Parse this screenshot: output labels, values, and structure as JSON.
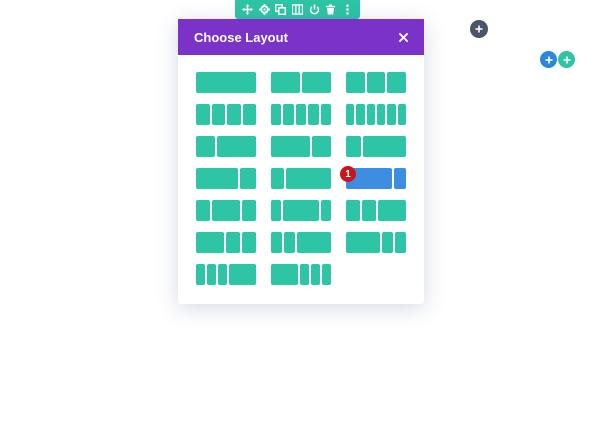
{
  "toolbar": {
    "icons": [
      "move-icon",
      "gear-icon",
      "duplicate-icon",
      "columns-icon",
      "power-icon",
      "trash-icon",
      "more-icon"
    ]
  },
  "modal": {
    "title": "Choose Layout",
    "close_icon": "close-icon",
    "header_color": "#7a32c8",
    "column_color": "#2ec4a6",
    "active_column_color": "#3d8ee2"
  },
  "layouts": [
    {
      "name": "one-column",
      "cols": [
        1
      ]
    },
    {
      "name": "two-equal",
      "cols": [
        1,
        1
      ]
    },
    {
      "name": "three-equal",
      "cols": [
        1,
        1,
        1
      ]
    },
    {
      "name": "four-equal",
      "cols": [
        1,
        1,
        1,
        1
      ]
    },
    {
      "name": "five-equal",
      "cols": [
        1,
        1,
        1,
        1,
        1
      ]
    },
    {
      "name": "six-equal",
      "cols": [
        1,
        1,
        1,
        1,
        1,
        1
      ]
    },
    {
      "name": "one-third-two-thirds",
      "cols": [
        1,
        2
      ]
    },
    {
      "name": "two-thirds-one-third",
      "cols": [
        2,
        1
      ]
    },
    {
      "name": "quarter-three-quarters",
      "cols": [
        1,
        3
      ]
    },
    {
      "name": "three-quarters-quarter",
      "cols": [
        3,
        1.15
      ]
    },
    {
      "name": "quarter-three-quarters-b",
      "cols": [
        1,
        3.4
      ]
    },
    {
      "name": "three-quarters-quarter-active",
      "cols": [
        4,
        1
      ]
    },
    {
      "name": "quarter-half-quarter",
      "cols": [
        1,
        2,
        1
      ]
    },
    {
      "name": "fifth-three-fifths-fifth",
      "cols": [
        1,
        3.5,
        1
      ]
    },
    {
      "name": "quarter-quarter-half",
      "cols": [
        1,
        1,
        2
      ]
    },
    {
      "name": "half-quarter-quarter",
      "cols": [
        2,
        1,
        1
      ]
    },
    {
      "name": "fifth-fifth-three-fifths",
      "cols": [
        1,
        1,
        3
      ]
    },
    {
      "name": "three-fifths-fifth-fifth",
      "cols": [
        3,
        1,
        1
      ]
    },
    {
      "name": "sixths-sixths-half",
      "cols": [
        1,
        1,
        1,
        3
      ]
    },
    {
      "name": "half-sixths-sixths",
      "cols": [
        3,
        1,
        1,
        1
      ]
    }
  ],
  "active_layout_index": 11,
  "badge": {
    "text": "1",
    "color": "#c8161d"
  },
  "add_buttons": [
    {
      "name": "add-section-button-dark",
      "icon": "plus-icon",
      "color": "#4a5568"
    },
    {
      "name": "add-row-button-blue",
      "icon": "plus-icon",
      "color": "#2b87da"
    },
    {
      "name": "add-module-button-teal",
      "icon": "plus-icon",
      "color": "#2ec4a6"
    }
  ]
}
